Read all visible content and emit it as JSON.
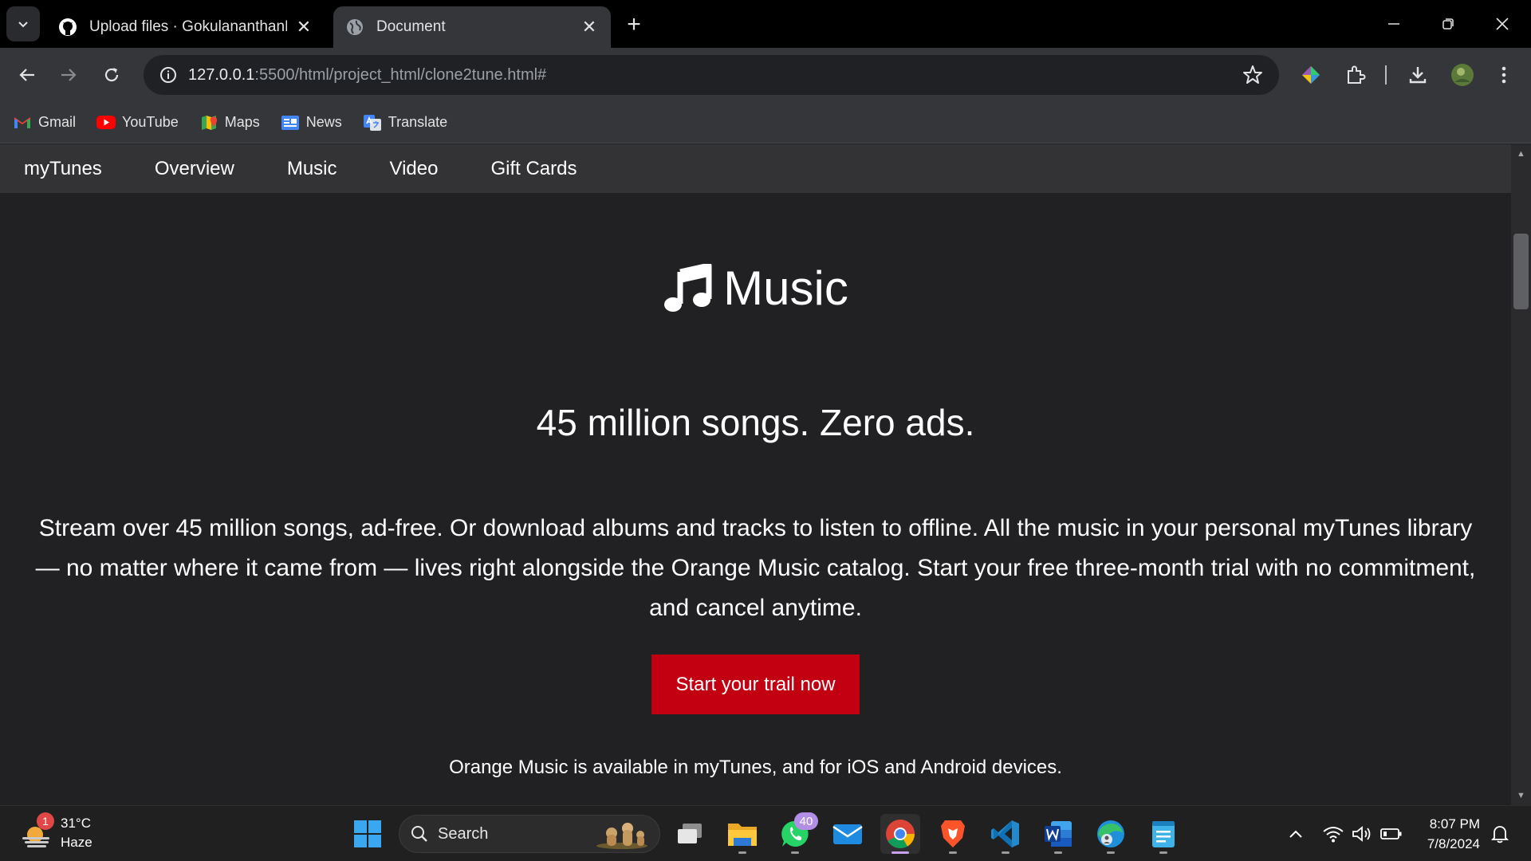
{
  "browser": {
    "tabs": [
      {
        "title": "Upload files · GokulananthanK/"
      },
      {
        "title": "Document"
      }
    ],
    "new_tab_label": "+",
    "url_host": "127.0.0.1",
    "url_rest": ":5500/html/project_html/clone2tune.html#",
    "bookmarks": [
      {
        "label": "Gmail"
      },
      {
        "label": "YouTube"
      },
      {
        "label": "Maps"
      },
      {
        "label": "News"
      },
      {
        "label": "Translate"
      }
    ]
  },
  "site": {
    "nav": [
      "myTunes",
      "Overview",
      "Music",
      "Video",
      "Gift Cards"
    ],
    "hero_title": "Music",
    "subhead": "45 million songs. Zero ads.",
    "paragraph": "Stream over 45 million songs, ad-free. Or download albums and tracks to listen to offline. All the music in your personal myTunes library — no matter where it came from — lives right alongside the Orange Music catalog. Start your free three-month trial with no commitment, and cancel anytime.",
    "cta_label": "Start your trail now",
    "availability": "Orange Music is available in myTunes, and for iOS and Android devices.",
    "accent_color": "#c20012"
  },
  "taskbar": {
    "weather_temp": "31°C",
    "weather_desc": "Haze",
    "weather_badge": "1",
    "search_label": "Search",
    "whatsapp_badge": "40",
    "time": "8:07 PM",
    "date": "7/8/2024"
  }
}
